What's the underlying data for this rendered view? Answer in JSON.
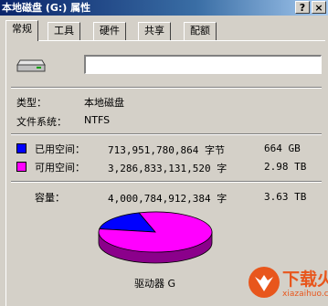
{
  "window": {
    "title": "本地磁盘 (G:) 属性",
    "help_button": "?",
    "close_button": "×"
  },
  "tabs": [
    "常规",
    "工具",
    "硬件",
    "共享",
    "配额"
  ],
  "name_field": {
    "value": ""
  },
  "info": {
    "type_label": "类型：",
    "type_value": "本地磁盘",
    "fs_label": "文件系统：",
    "fs_value": "NTFS"
  },
  "space": {
    "used_label": "已用空间：",
    "used_bytes": "713,951,780,864 字节",
    "used_size": "664 GB",
    "free_label": "可用空间：",
    "free_bytes": "3,286,833,131,520 字",
    "free_size": "2.98 TB",
    "capacity_label": "容量：",
    "capacity_bytes": "4,000,784,912,384 字",
    "capacity_size": "3.63 TB",
    "drive_label": "驱动器 G"
  },
  "colors": {
    "used": "#0000ff",
    "free": "#ff00ff"
  },
  "chart_data": {
    "type": "pie",
    "categories": [
      "已用空间",
      "可用空间"
    ],
    "values": [
      713951780864,
      3286833131520
    ]
  },
  "watermark": {
    "text": "下载火",
    "url": "xiazaihuo.com"
  }
}
